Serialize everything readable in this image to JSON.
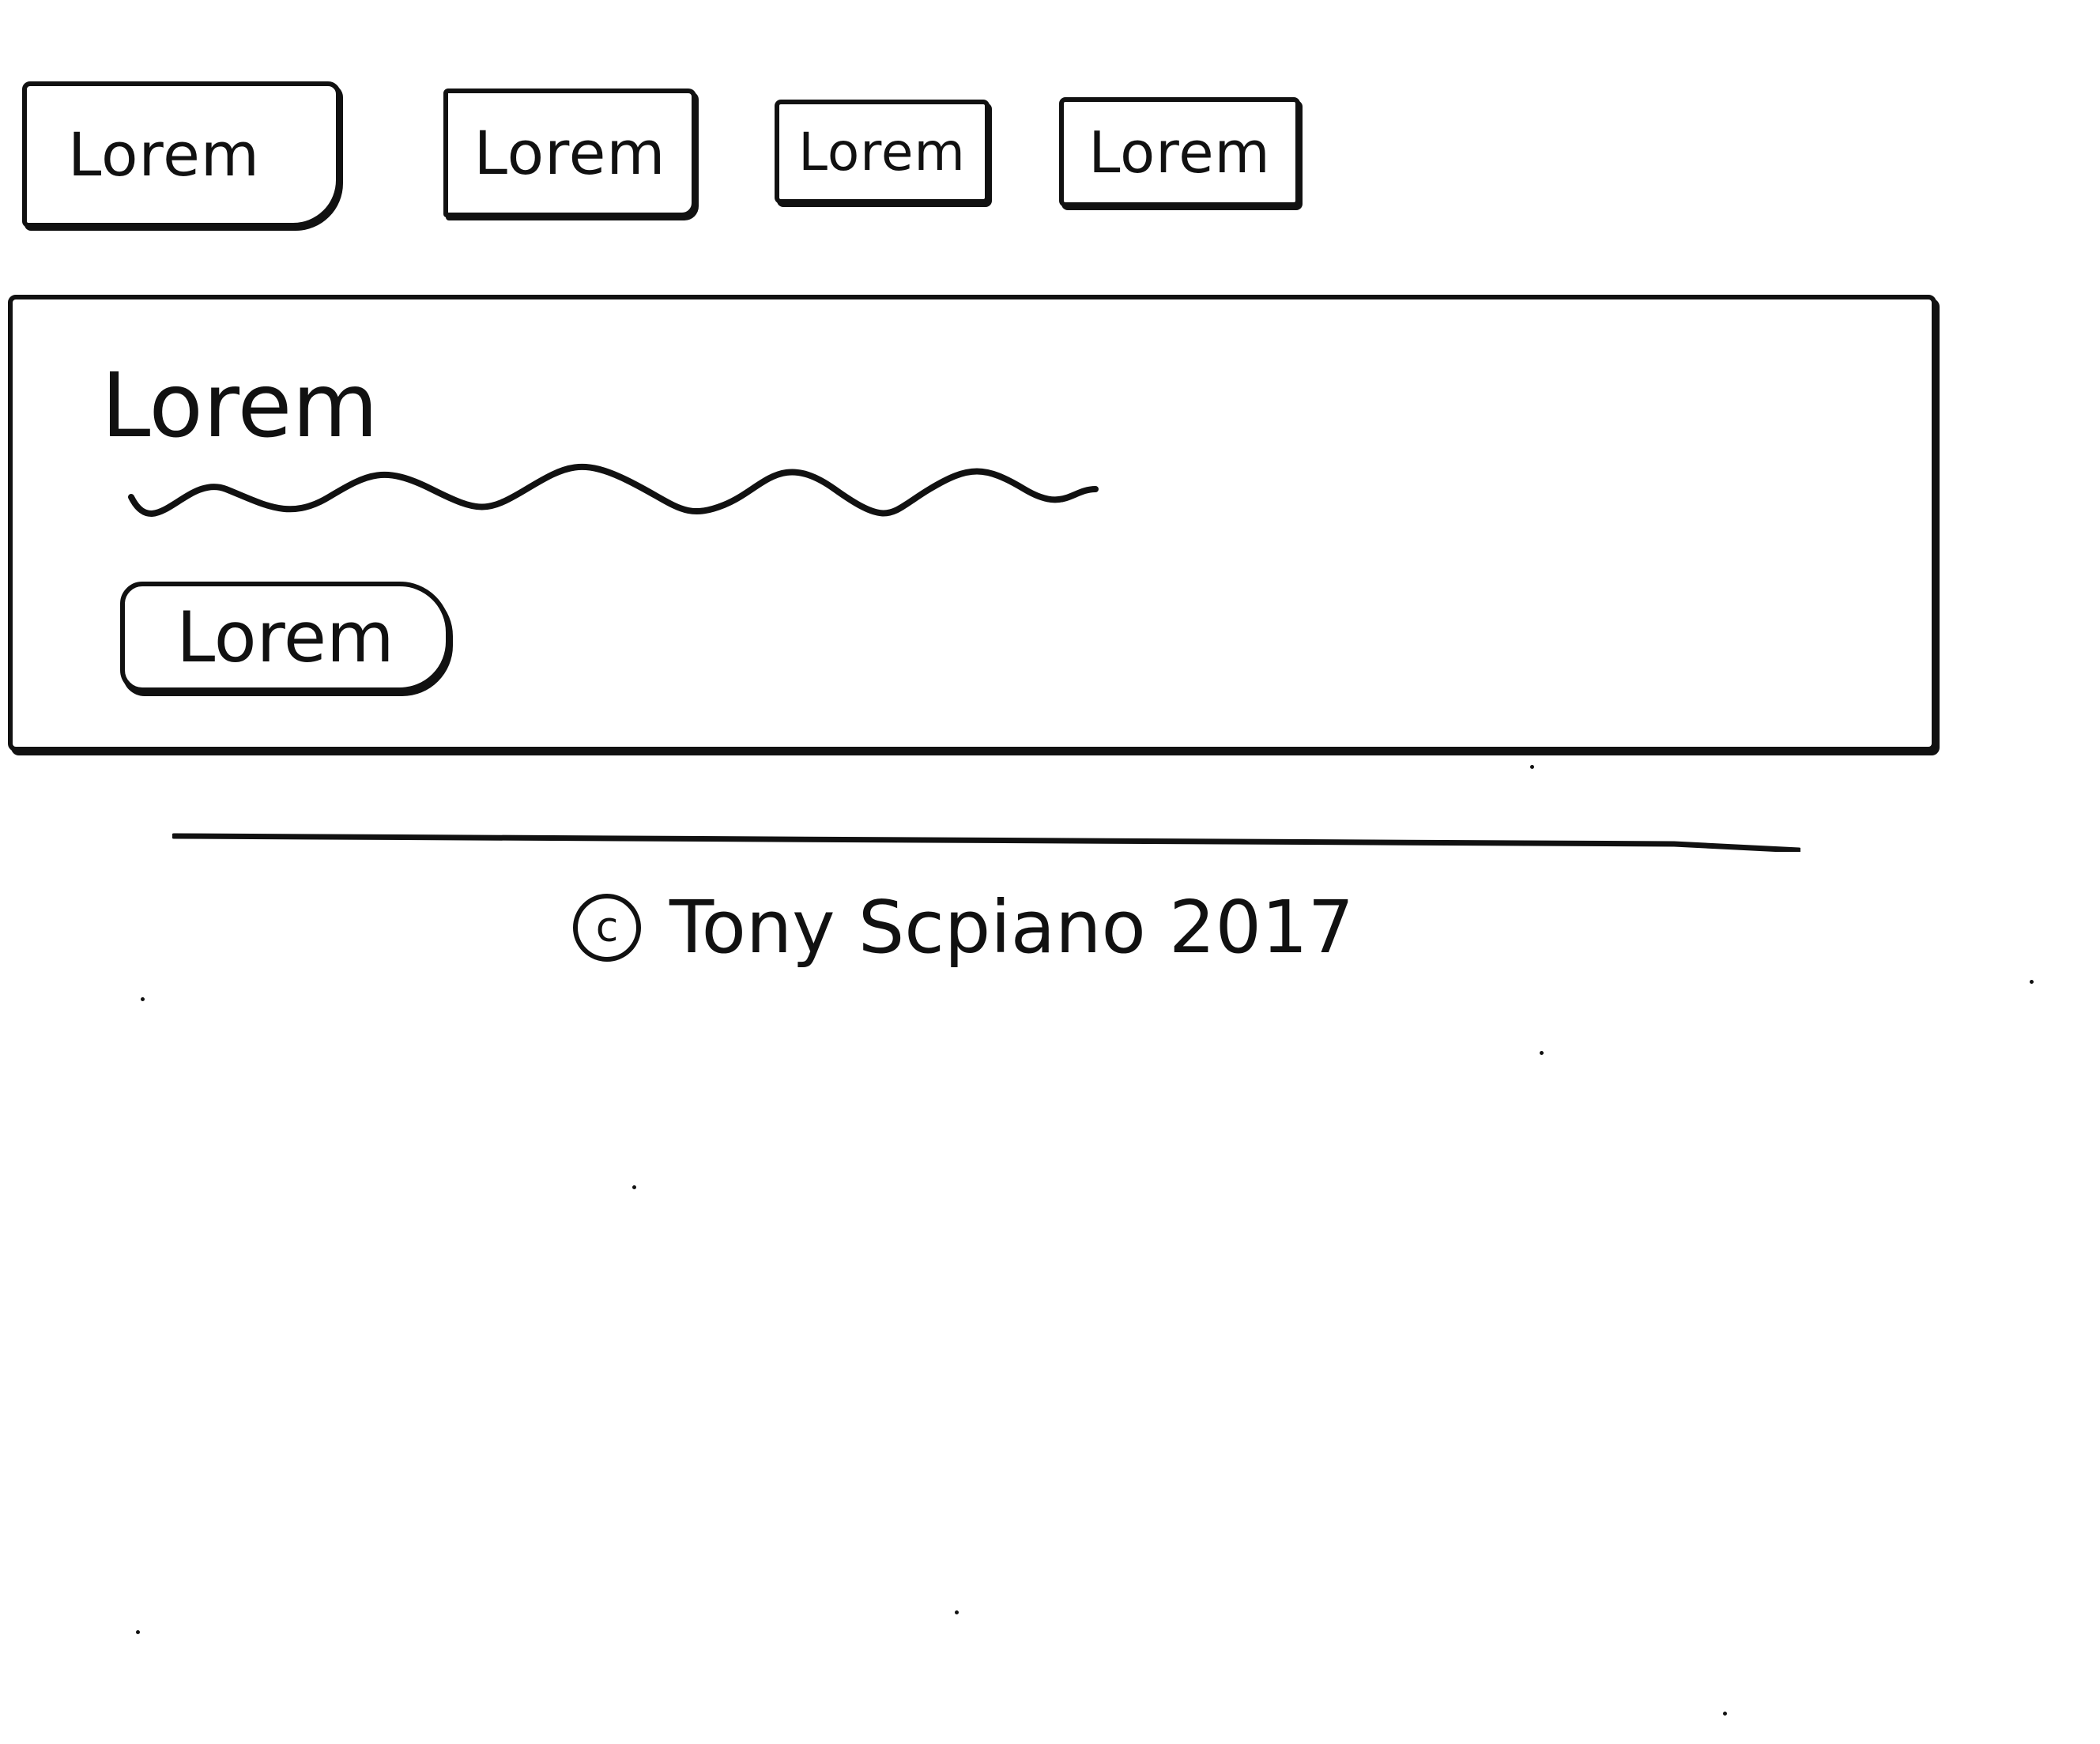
{
  "nav": {
    "buttons": [
      {
        "label": "Lorem"
      },
      {
        "label": "Lorem"
      },
      {
        "label": "Lorem"
      },
      {
        "label": "Lorem"
      }
    ]
  },
  "panel": {
    "title": "Lorem",
    "button_label": "Lorem"
  },
  "footer": {
    "copyright_symbol": "c",
    "text": "Tony Scpiano 2017"
  },
  "colors": {
    "ink": "#111111",
    "background": "#ffffff"
  }
}
